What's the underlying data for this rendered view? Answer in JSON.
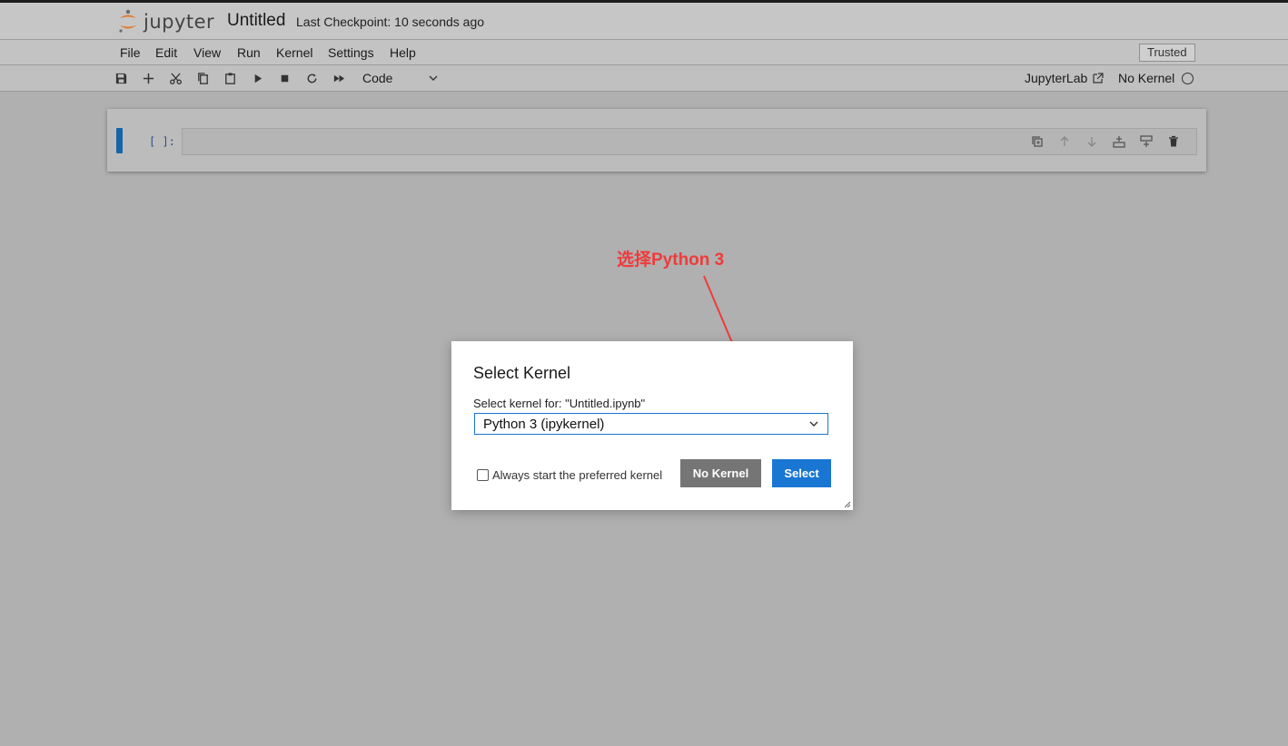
{
  "header": {
    "logo_text": "jupyter",
    "notebook_title": "Untitled",
    "checkpoint": "Last Checkpoint: 10 seconds ago"
  },
  "menu": {
    "items": [
      {
        "label": "File"
      },
      {
        "label": "Edit"
      },
      {
        "label": "View"
      },
      {
        "label": "Run"
      },
      {
        "label": "Kernel"
      },
      {
        "label": "Settings"
      },
      {
        "label": "Help"
      }
    ],
    "trusted_label": "Trusted"
  },
  "toolbar": {
    "buttons": [
      "save-icon",
      "add-cell-icon",
      "cut-icon",
      "copy-icon",
      "paste-icon",
      "run-icon",
      "stop-icon",
      "restart-icon",
      "fast-forward-icon"
    ],
    "cell_type": "Code",
    "jupyterlab_label": "JupyterLab",
    "kernel_status": "No Kernel"
  },
  "cell": {
    "prompt": "[ ]:",
    "tools": [
      "duplicate-icon",
      "move-up-icon",
      "move-down-icon",
      "insert-above-icon",
      "insert-below-icon",
      "delete-icon"
    ]
  },
  "annotation": {
    "text": "选择Python 3",
    "color": "#ef3b3b"
  },
  "dialog": {
    "title": "Select Kernel",
    "label": "Select kernel for: \"Untitled.ipynb\"",
    "selected_kernel": "Python 3 (ipykernel)",
    "checkbox_label": "Always start the preferred kernel",
    "checkbox_checked": false,
    "no_kernel_label": "No Kernel",
    "select_label": "Select"
  },
  "colors": {
    "accent": "#1976d2",
    "secondary_button": "#757575",
    "overlay_bg": "#b0b0b0"
  }
}
